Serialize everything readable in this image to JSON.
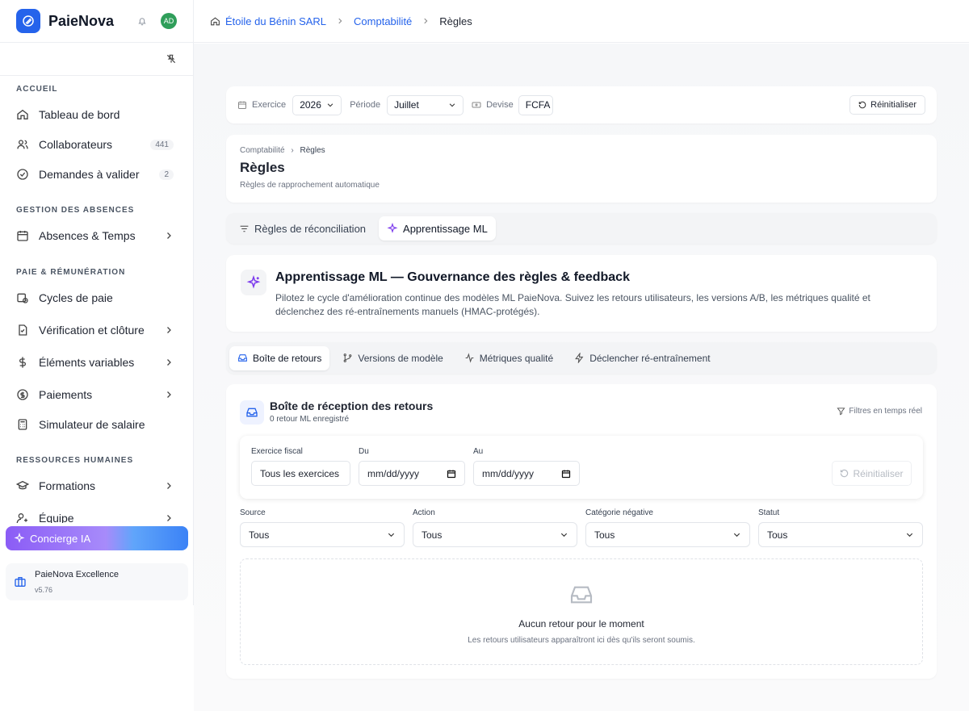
{
  "app": {
    "name": "PaieNova",
    "avatar": "AD"
  },
  "sidebar": {
    "sections": [
      "ACCUEIL",
      "GESTION DES ABSENCES",
      "PAIE & RÉMUNÉRATION",
      "RESSOURCES HUMAINES"
    ],
    "items": [
      {
        "label": "Tableau de bord"
      },
      {
        "label": "Collaborateurs",
        "badge": "441"
      },
      {
        "label": "Demandes à valider",
        "badge": "2"
      },
      {
        "label": "Absences & Temps"
      },
      {
        "label": "Cycles de paie"
      },
      {
        "label": "Vérification et clôture"
      },
      {
        "label": "Éléments variables"
      },
      {
        "label": "Paiements"
      },
      {
        "label": "Simulateur de salaire"
      },
      {
        "label": "Formations"
      },
      {
        "label": "Équipe"
      }
    ],
    "concierge": "Concierge IA",
    "plan": {
      "name": "PaieNova Excellence",
      "version": "v5.76"
    }
  },
  "topbar": {
    "company": "Étoile du Bénin SARL",
    "section": "Comptabilité",
    "page": "Règles"
  },
  "filters": {
    "exercice_label": "Exercice",
    "exercice": "2026",
    "periode_label": "Période",
    "periode": "Juillet",
    "devise_label": "Devise",
    "devise": "FCFA",
    "reset": "Réinitialiser"
  },
  "header": {
    "crumb1": "Comptabilité",
    "crumb2": "Règles",
    "title": "Règles",
    "subtitle": "Règles de rapprochement automatique"
  },
  "tabs": [
    "Règles de réconciliation",
    "Apprentissage ML"
  ],
  "intro": {
    "title": "Apprentissage ML — Gouvernance des règles & feedback",
    "text": "Pilotez le cycle d'amélioration continue des modèles ML PaieNova. Suivez les retours utilisateurs, les versions A/B, les métriques qualité et déclenchez des ré-entraînements manuels (HMAC-protégés)."
  },
  "subtabs": [
    "Boîte de retours",
    "Versions de modèle",
    "Métriques qualité",
    "Déclencher ré-entraînement"
  ],
  "inbox": {
    "title": "Boîte de réception des retours",
    "subtitle": "0 retour ML enregistré",
    "realtime": "Filtres en temps réel",
    "fiscal_label": "Exercice fiscal",
    "fiscal_value": "Tous les exercices",
    "from_label": "Du",
    "from_value": "mm/dd/yyyy",
    "to_label": "Au",
    "to_value": "mm/dd/yyyy",
    "reset": "Réinitialiser",
    "selects": [
      {
        "label": "Source",
        "value": "Tous"
      },
      {
        "label": "Action",
        "value": "Tous"
      },
      {
        "label": "Catégorie négative",
        "value": "Tous"
      },
      {
        "label": "Statut",
        "value": "Tous"
      }
    ],
    "empty_title": "Aucun retour pour le moment",
    "empty_text": "Les retours utilisateurs apparaîtront ici dès qu'ils seront soumis."
  }
}
